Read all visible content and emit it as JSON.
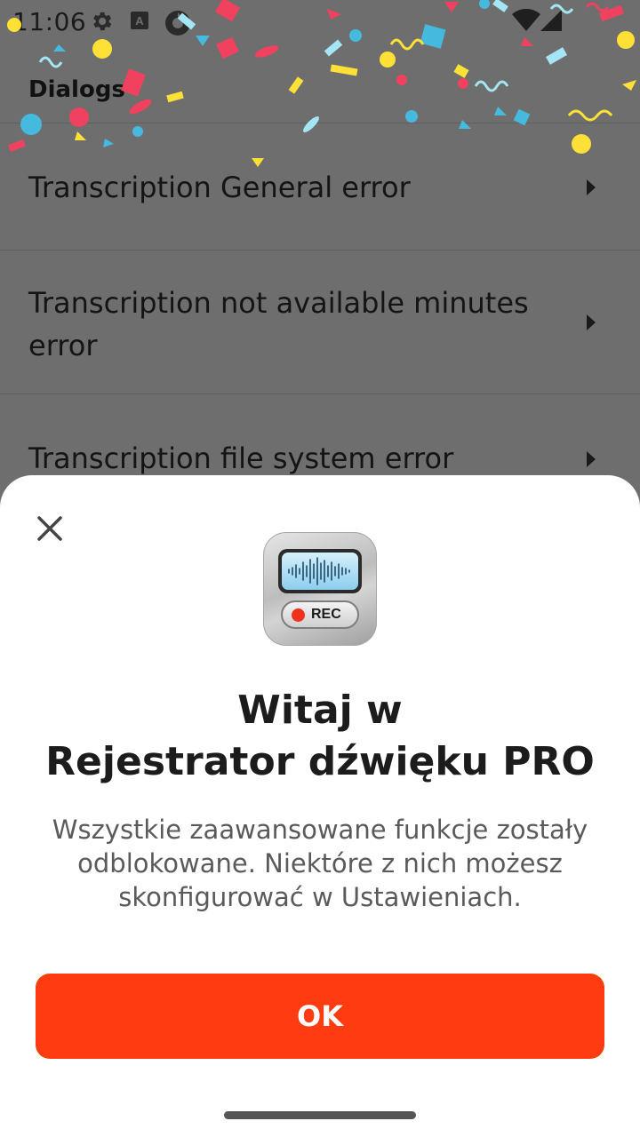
{
  "status_bar": {
    "time": "11:06",
    "icons": [
      "gear-icon",
      "keyboard-a-icon",
      "sync-icon",
      "wifi-icon",
      "signal-icon"
    ]
  },
  "list": {
    "section_title": "Dialogs",
    "items": [
      {
        "label": "Transcription General error"
      },
      {
        "label": "Transcription not available minutes error"
      },
      {
        "label": "Transcription file system error"
      }
    ]
  },
  "dialog": {
    "icon": {
      "name": "voice-recorder-app-icon",
      "rec_label": "REC"
    },
    "title_line1": "Witaj w",
    "title_line2": "Rejestrator dźwięku PRO",
    "body": "Wszystkie zaawansowane funkcje zostały odblokowane. Niektóre z nich możesz skonfigurować w Ustawieniach.",
    "ok_label": "OK"
  },
  "colors": {
    "accent": "#ff3b12",
    "scrim": "#6e6e6e",
    "sheet": "#ffffff",
    "confetti": [
      "#f0425e",
      "#ffe036",
      "#45b9de",
      "#a4e6f5"
    ]
  }
}
